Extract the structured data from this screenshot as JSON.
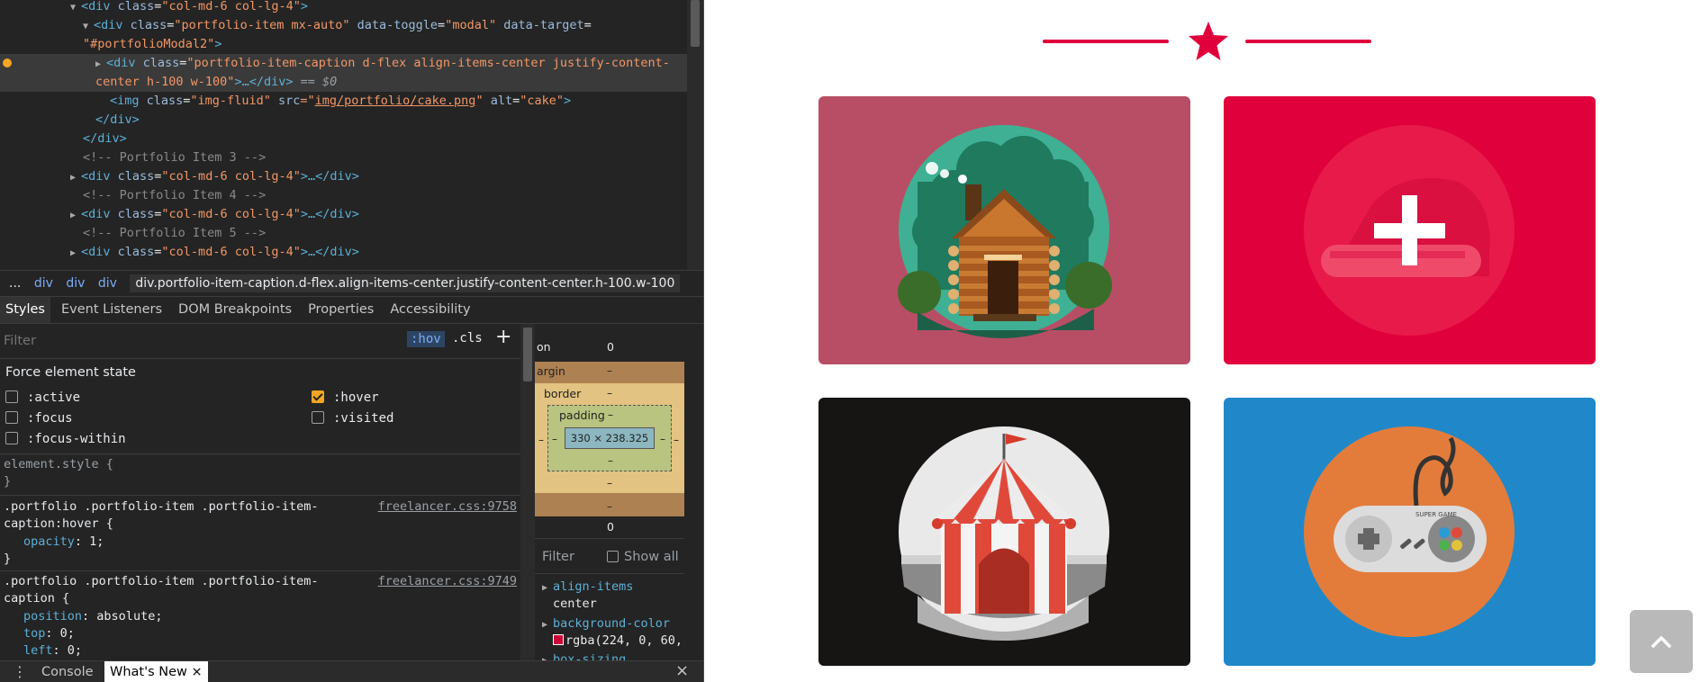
{
  "elements_panel": {
    "line0": {
      "tag_open": "<div ",
      "attr": "class",
      "val": "\"col-md-6 col-lg-4\"",
      "close": ">"
    },
    "line1": {
      "tag_open": "<div ",
      "attr1": "class",
      "val1": "\"portfolio-item mx-auto\"",
      "attr2": "data-toggle",
      "val2": "\"modal\"",
      "attr3": "data-target",
      "val3a": "="
    },
    "line1b": {
      "val3b": "\"#portfolioModal2\"",
      "close": ">"
    },
    "line2": {
      "tag_open": "<div ",
      "attr": "class",
      "val": "\"portfolio-item-caption d-flex align-items-center justify-content-"
    },
    "line2b": {
      "val": "center h-100 w-100\"",
      "rest": ">…</div>",
      "eq": "== $0"
    },
    "line3": {
      "tag_open": "<img ",
      "attr1": "class",
      "val1": "\"img-fluid\"",
      "attr2": "src",
      "val2a": "=\"",
      "link": "img/portfolio/cake.png",
      "val2b": "\"",
      "attr3": "alt",
      "val3": "\"cake\"",
      "close": ">"
    },
    "line4": "</div>",
    "line5": "</div>",
    "comment3": "<!-- Portfolio Item 3 -->",
    "collapsed_tag": "<div ",
    "collapsed_attr": "class",
    "collapsed_val": "\"col-md-6 col-lg-4\"",
    "collapsed_rest": ">…</div>",
    "comment4": "<!-- Portfolio Item 4 -->",
    "comment5": "<!-- Portfolio Item 5 -->"
  },
  "breadcrumb": {
    "ellipsis": "...",
    "items": [
      "div",
      "div",
      "div"
    ],
    "current": "div.portfolio-item-caption.d-flex.align-items-center.justify-content-center.h-100.w-100"
  },
  "tabs": [
    "Styles",
    "Event Listeners",
    "DOM Breakpoints",
    "Properties",
    "Accessibility"
  ],
  "styles": {
    "filter_placeholder": "Filter",
    "hov": ":hov",
    "cls": ".cls",
    "plus": "+",
    "force_title": "Force element state",
    "states": {
      "active": ":active",
      "focus": ":focus",
      "focus_within": ":focus-within",
      "hover": ":hover",
      "visited": ":visited"
    },
    "element_style": "element.style {",
    "close_brace": "}",
    "rule1": {
      "selector1": ".portfolio .portfolio-item .portfolio-item-",
      "selector2": "caption:hover {",
      "source": "freelancer.css:9758",
      "prop": "opacity",
      "value": " 1;"
    },
    "rule2": {
      "selector1": ".portfolio .portfolio-item .portfolio-item-",
      "selector2": "caption {",
      "source": "freelancer.css:9749",
      "props": [
        {
          "prop": "position",
          "value": " absolute;"
        },
        {
          "prop": "top",
          "value": " 0;"
        },
        {
          "prop": "left",
          "value": " 0;"
        }
      ]
    }
  },
  "box_model": {
    "position_label": "on",
    "position_value": "0",
    "margin_label": "argin",
    "border_label": "border",
    "padding_label": "padding",
    "content": "330 × 238.325",
    "dash": "–",
    "bottom_value": "0",
    "filter": "Filter",
    "show_all": "Show all",
    "computed": [
      {
        "name": "align-items",
        "value": "center"
      },
      {
        "name": "background-color",
        "value": "rgba(224, 0, 60,"
      },
      {
        "name": "box-sizing",
        "value": ""
      }
    ]
  },
  "drawer": {
    "dots": "⋮",
    "console": "Console",
    "whats_new": "What's New",
    "close": "×"
  },
  "page": {
    "accent_color": "#e0003c",
    "divider_icon": "star-icon",
    "tiles": [
      {
        "name": "portfolio-item-cabin",
        "bg": "#b84e65",
        "image": "log-cabin"
      },
      {
        "name": "portfolio-item-cake",
        "bg": "#e0003c",
        "image": "cake-hover-plus"
      },
      {
        "name": "portfolio-item-circus",
        "bg": "#171414",
        "image": "circus-tent"
      },
      {
        "name": "portfolio-item-game",
        "bg": "#2088c8",
        "image": "game-controller"
      }
    ],
    "back_to_top_icon": "chevron-up-icon",
    "controller_brand": "SUPER GAME"
  }
}
